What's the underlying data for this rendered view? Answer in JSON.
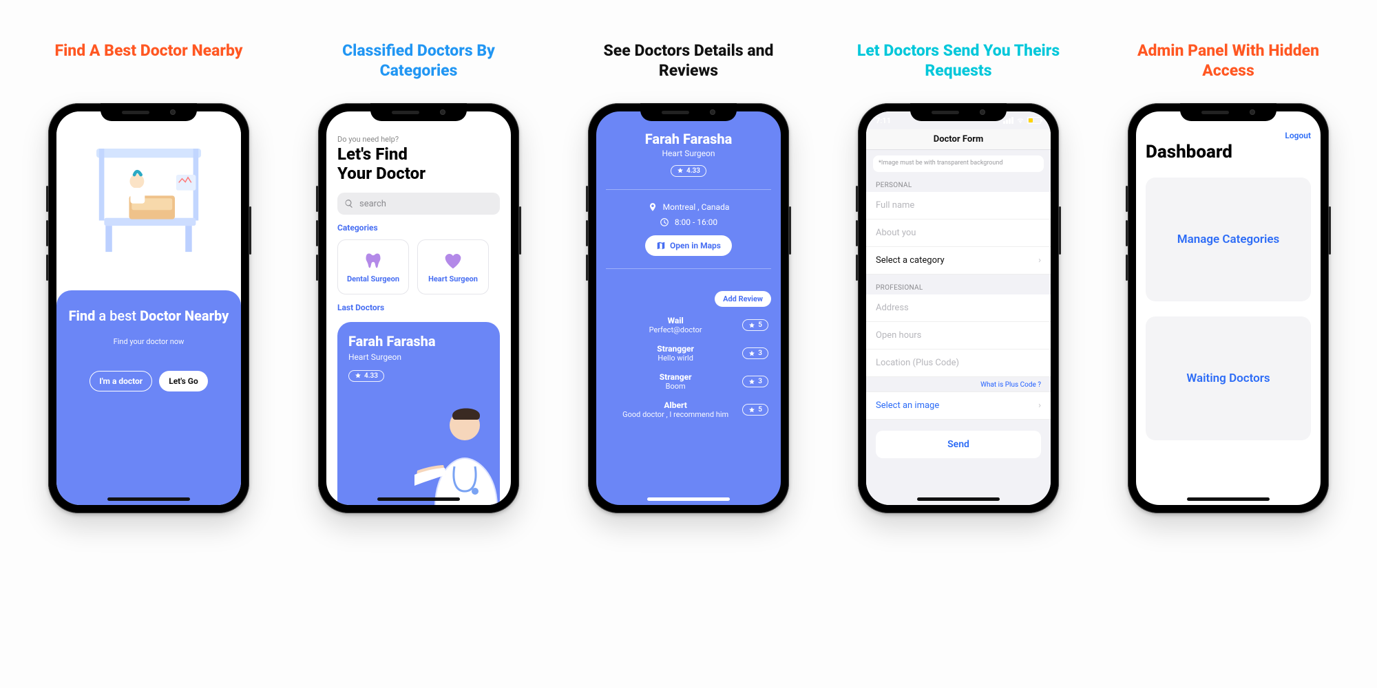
{
  "captions": [
    "Find A Best Doctor Nearby",
    "Classified Doctors By Categories",
    "See Doctors Details and Reviews",
    "Let Doctors Send You Theirs Requests",
    "Admin Panel With Hidden Access"
  ],
  "colors": {
    "accent_blue": "#6b86f6",
    "link_blue": "#2d6cf6",
    "orange": "#ff5722",
    "cyan": "#00c7da"
  },
  "screen1": {
    "headline_1": "Find",
    "headline_2": "a best",
    "headline_3": "Doctor Nearby",
    "subtitle": "Find your doctor now",
    "btn_doctor": "I'm a doctor",
    "btn_go": "Let's Go"
  },
  "screen2": {
    "help": "Do you need help?",
    "title_a": "Let's Find",
    "title_b": "Your Doctor",
    "search_placeholder": "search",
    "sec_categories": "Categories",
    "cats": [
      "Dental Surgeon",
      "Heart Surgeon"
    ],
    "sec_last": "Last Doctors",
    "doc_name": "Farah Farasha",
    "doc_role": "Heart Surgeon",
    "doc_rating": "4.33"
  },
  "screen3": {
    "name": "Farah Farasha",
    "role": "Heart Surgeon",
    "rating": "4.33",
    "location": "Montreal , Canada",
    "hours": "8:00 - 16:00",
    "open_maps": "Open in Maps",
    "add_review": "Add Review",
    "reviews": [
      {
        "name": "Wail",
        "msg": "Perfect@doctor",
        "stars": "5"
      },
      {
        "name": "Strangger",
        "msg": "Hello wirld",
        "stars": "3"
      },
      {
        "name": "Stranger",
        "msg": "Boom",
        "stars": "3"
      },
      {
        "name": "Albert",
        "msg": "Good doctor , I recommend him",
        "stars": "5"
      }
    ]
  },
  "screen4": {
    "status_time": "7:11",
    "nav_title": "Doctor Form",
    "hint": "*Image must be with transparent background",
    "sect_personal": "PERSONAL",
    "ph_fullname": "Full name",
    "ph_about": "About you",
    "select_cat": "Select a category",
    "sect_prof": "PROFESIONAL",
    "ph_address": "Address",
    "ph_hours": "Open hours",
    "ph_location": "Location (Plus Code)",
    "plus_link": "What is Plus Code ?",
    "select_img": "Select an image",
    "send": "Send"
  },
  "screen5": {
    "logout": "Logout",
    "title": "Dashboard",
    "card1": "Manage Categories",
    "card2": "Waiting Doctors"
  }
}
